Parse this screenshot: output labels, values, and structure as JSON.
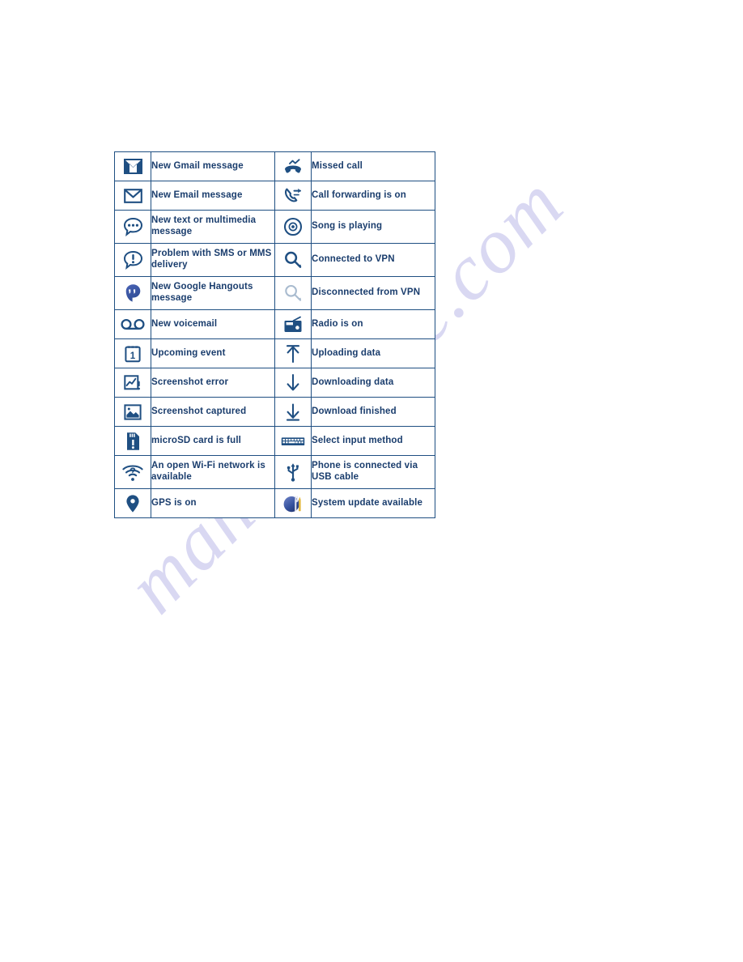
{
  "document": {
    "watermark": "manualshive.com",
    "accent_color": "#1f4f82",
    "text_color": "#1a3d6d",
    "background_color": "#ffffff"
  },
  "icon_table": {
    "name": "status-and-notification-icons",
    "rows": [
      {
        "left": {
          "icon": "gmail-envelope-icon",
          "label": "New Gmail message"
        },
        "right": {
          "icon": "missed-call-icon",
          "label": "Missed call"
        }
      },
      {
        "left": {
          "icon": "email-envelope-icon",
          "label": "New Email message"
        },
        "right": {
          "icon": "call-forwarding-icon",
          "label": "Call forwarding is on"
        }
      },
      {
        "left": {
          "icon": "sms-message-bubble-icon",
          "label": "New text or multimedia message"
        },
        "right": {
          "icon": "music-disc-icon",
          "label": "Song is playing"
        }
      },
      {
        "left": {
          "icon": "sms-problem-bubble-icon",
          "label": "Problem with SMS or MMS delivery"
        },
        "right": {
          "icon": "vpn-key-connected-icon",
          "label": "Connected to VPN"
        }
      },
      {
        "left": {
          "icon": "google-hangouts-icon",
          "label": "New Google Hangouts message"
        },
        "right": {
          "icon": "vpn-key-disconnected-icon",
          "label": "Disconnected from VPN"
        }
      },
      {
        "left": {
          "icon": "voicemail-icon",
          "label": "New voicemail"
        },
        "right": {
          "icon": "radio-icon",
          "label": "Radio is on"
        }
      },
      {
        "left": {
          "icon": "calendar-event-icon",
          "label": "Upcoming event"
        },
        "right": {
          "icon": "upload-arrow-icon",
          "label": "Uploading data"
        }
      },
      {
        "left": {
          "icon": "screenshot-error-icon",
          "label": "Screenshot error"
        },
        "right": {
          "icon": "download-arrow-icon",
          "label": "Downloading data"
        }
      },
      {
        "left": {
          "icon": "screenshot-captured-icon",
          "label": "Screenshot captured"
        },
        "right": {
          "icon": "download-finished-icon",
          "label": "Download finished"
        }
      },
      {
        "left": {
          "icon": "microsd-card-full-icon",
          "label": "microSD card is full"
        },
        "right": {
          "icon": "keyboard-input-method-icon",
          "label": "Select input method"
        }
      },
      {
        "left": {
          "icon": "open-wifi-network-icon",
          "label": "An open Wi-Fi network is available"
        },
        "right": {
          "icon": "usb-connection-icon",
          "label": "Phone is connected via USB cable"
        }
      },
      {
        "left": {
          "icon": "gps-location-icon",
          "label": "GPS is on"
        },
        "right": {
          "icon": "system-update-icon",
          "label": "System update available"
        }
      }
    ]
  }
}
